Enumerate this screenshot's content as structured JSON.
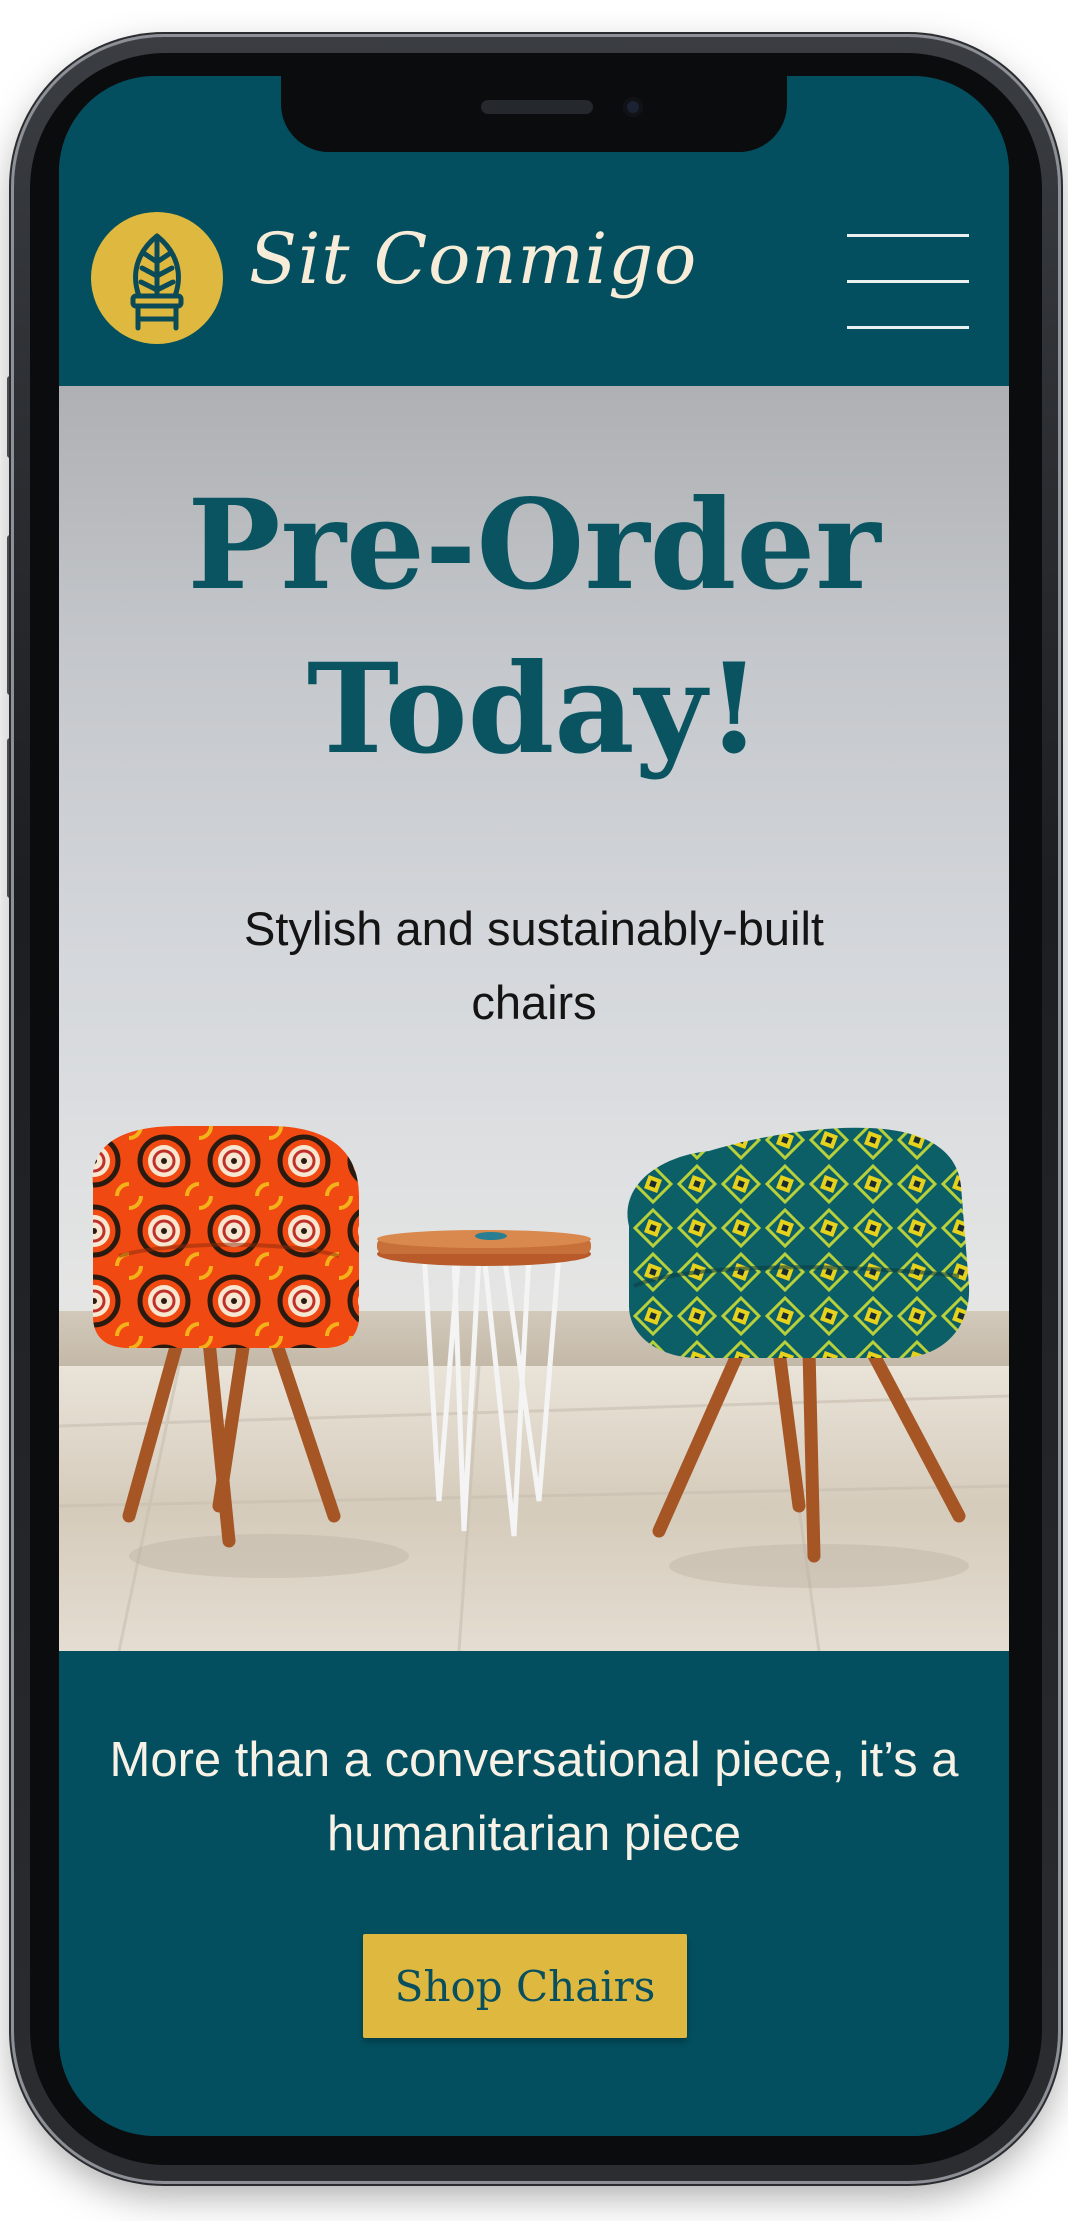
{
  "header": {
    "brand_name": "Sit Conmigo",
    "logo_icon": "chair-leaf-logo-icon",
    "menu_icon": "hamburger-menu-icon"
  },
  "hero": {
    "title": "Pre-Order Today!",
    "subtitle": "Stylish and sustainably-built chairs",
    "image": "two-patterned-armchairs-with-side-table-photo"
  },
  "promo": {
    "text": "More than a conversational piece, it’s a humanitarian piece",
    "button_label": "Shop Chairs"
  },
  "colors": {
    "brand_teal": "#034f5f",
    "accent_gold": "#dfb93f",
    "cream_text": "#f6ecd8",
    "title_teal": "#0a5462"
  }
}
